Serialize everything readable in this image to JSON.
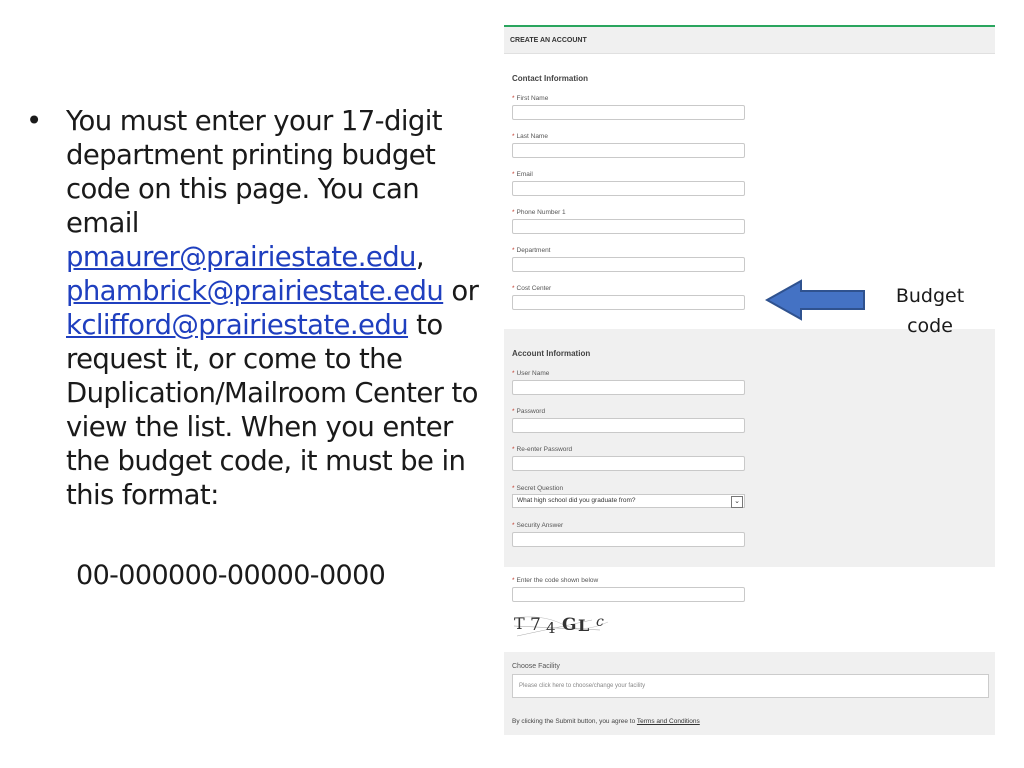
{
  "slide": {
    "bullet": "•",
    "text_part1": "You must enter your 17-digit department printing budget code on this page. You can email ",
    "email1": "pmaurer@prairiestate.edu",
    "comma": ",",
    "email2": "phambrick@prairiestate.edu",
    "or_text": " or ",
    "email3": "kclifford@prairiestate.edu",
    "text_part2": " to request it, or come to the Duplication/Mailroom Center to view the list. When you enter the budget code, it must be in this format:",
    "format_code": "00-000000-00000-0000"
  },
  "form": {
    "header": "CREATE AN ACCOUNT",
    "contact_title": "Contact Information",
    "contact_fields": [
      "First Name",
      "Last Name",
      "Email",
      "Phone Number 1",
      "Department",
      "Cost Center"
    ],
    "account_title": "Account Information",
    "account_fields": [
      "User Name",
      "Password",
      "Re-enter Password"
    ],
    "secret_question_label": "Secret Question",
    "secret_question_value": "What high school did you graduate from?",
    "security_answer_label": "Security Answer",
    "captcha_label": "Enter the code shown below",
    "captcha_chars": [
      "T",
      "7",
      "4",
      "G",
      "L",
      "c"
    ],
    "facility_title": "Choose Facility",
    "facility_placeholder": "Please click here to choose/change your facility",
    "terms_text": "By clicking the Submit button, you agree to ",
    "terms_link": "Terms and Conditions",
    "required_mark": "*"
  },
  "annotation": {
    "label_line1": "Budget",
    "label_line2": "code",
    "arrow_color": "#4472c4",
    "arrow_border": "#2f528f"
  },
  "colors": {
    "accent_green": "#2aa55e",
    "link_blue": "#1f3fbf",
    "band_gray": "#f0f0f0"
  }
}
